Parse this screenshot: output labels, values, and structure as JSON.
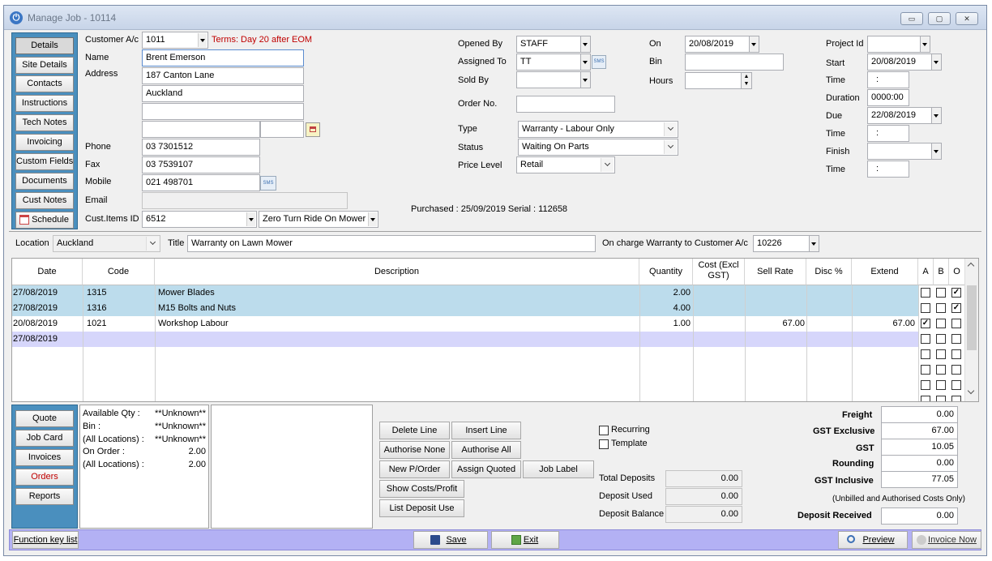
{
  "window": {
    "title": "Manage Job - 10114"
  },
  "nav": {
    "items": [
      "Details",
      "Site Details",
      "Contacts",
      "Instructions",
      "Tech Notes",
      "Invoicing",
      "Custom Fields",
      "Documents",
      "Cust Notes",
      "Schedule"
    ]
  },
  "customer": {
    "account_label": "Customer A/c",
    "account": "1011",
    "terms": "Terms: Day 20 after EOM",
    "name_label": "Name",
    "name": "Brent Emerson",
    "address_label": "Address",
    "address1": "187 Canton Lane",
    "address2": "Auckland",
    "phone_label": "Phone",
    "phone": "03 7301512",
    "fax_label": "Fax",
    "fax": "03 7539107",
    "mobile_label": "Mobile",
    "mobile": "021 498701",
    "email_label": "Email",
    "cust_items_label": "Cust.Items ID",
    "cust_items_id": "6512",
    "cust_item_name": "Zero Turn Ride On Mower",
    "sms_label": "SMS"
  },
  "job": {
    "opened_by_label": "Opened By",
    "opened_by": "STAFF",
    "assigned_to_label": "Assigned To",
    "assigned_to": "TT",
    "sold_by_label": "Sold By",
    "order_no_label": "Order No.",
    "type_label": "Type",
    "type": "Warranty - Labour Only",
    "status_label": "Status",
    "status": "Waiting On Parts",
    "price_level_label": "Price Level",
    "price_level": "Retail",
    "on_label": "On",
    "on_date": "20/08/2019",
    "bin_label": "Bin",
    "hours_label": "Hours",
    "purchased_text": "Purchased : 25/09/2019   Serial : 112658"
  },
  "schedule": {
    "project_id_label": "Project Id",
    "start_label": "Start",
    "start": "20/08/2019",
    "time_label": "Time",
    "start_time": ":",
    "duration_label": "Duration",
    "duration": "0000:00",
    "due_label": "Due",
    "due": "22/08/2019",
    "due_time": ":",
    "finish_label": "Finish",
    "finish_time": ":"
  },
  "location": {
    "location_label": "Location",
    "location": "Auckland",
    "title_label": "Title",
    "title": "Warranty on Lawn Mower",
    "oncharge_label": "On charge Warranty to Customer A/c",
    "oncharge_account": "10226"
  },
  "grid": {
    "headers": [
      "Date",
      "Code",
      "Description",
      "Quantity",
      "Cost   (Excl GST)",
      "Sell Rate",
      "Disc %",
      "Extend",
      "A",
      "B",
      "O"
    ],
    "rows": [
      {
        "date": "27/08/2019",
        "code": "1315",
        "description": "Mower Blades",
        "quantity": "2.00",
        "sell_rate": "",
        "extend": "",
        "a": false,
        "b": false,
        "o": true
      },
      {
        "date": "27/08/2019",
        "code": "1316",
        "description": "M15 Bolts and Nuts",
        "quantity": "4.00",
        "sell_rate": "",
        "extend": "",
        "a": false,
        "b": false,
        "o": true
      },
      {
        "date": "20/08/2019",
        "code": "1021",
        "description": "Workshop Labour",
        "quantity": "1.00",
        "sell_rate": "67.00",
        "extend": "67.00",
        "a": true,
        "b": false,
        "o": false
      },
      {
        "date": "27/08/2019",
        "code": "",
        "description": "",
        "quantity": "",
        "sell_rate": "",
        "extend": "",
        "a": false,
        "b": false,
        "o": false
      }
    ]
  },
  "lower_nav": {
    "items": [
      "Quote",
      "Job Card",
      "Invoices",
      "Orders",
      "Reports"
    ]
  },
  "availability": {
    "available_label": "Available Qty :",
    "available": "**Unknown**",
    "bin_label": "Bin :",
    "bin": "**Unknown**",
    "all_locations_label": "(All Locations) :",
    "all_locations": "**Unknown**",
    "on_order_label": "On Order :",
    "on_order": "2.00",
    "on_order_all_label": "(All Locations) :",
    "on_order_all": "2.00"
  },
  "actions": {
    "delete_line": "Delete Line",
    "insert_line": "Insert Line",
    "authorise_none": "Authorise None",
    "authorise_all": "Authorise All",
    "new_porder": "New P/Order",
    "assign_quoted": "Assign Quoted",
    "job_label": "Job Label",
    "show_costs": "Show Costs/Profit",
    "list_deposit": "List Deposit Use"
  },
  "options": {
    "recurring": "Recurring",
    "template": "Template"
  },
  "deposits": {
    "total_label": "Total Deposits",
    "total": "0.00",
    "used_label": "Deposit Used",
    "used": "0.00",
    "balance_label": "Deposit Balance",
    "balance": "0.00"
  },
  "totals": {
    "freight_label": "Freight",
    "freight": "0.00",
    "gst_excl_label": "GST Exclusive",
    "gst_excl": "67.00",
    "gst_label": "GST",
    "gst": "10.05",
    "rounding_label": "Rounding",
    "rounding": "0.00",
    "gst_incl_label": "GST Inclusive",
    "gst_incl": "77.05",
    "note": "(Unbilled and Authorised Costs Only)",
    "deposit_received_label": "Deposit Received",
    "deposit_received": "0.00"
  },
  "footer": {
    "function_keys": "Function key list",
    "save": "Save",
    "exit": "Exit",
    "preview": "Preview",
    "invoice_now": "Invoice Now"
  },
  "colors": {
    "nav_blue": "#4a8fbe",
    "row_blue": "#bcdcec",
    "row_lilac": "#d6d6fb",
    "status_bar": "#b3b1f4",
    "terms_red": "#c00000"
  }
}
